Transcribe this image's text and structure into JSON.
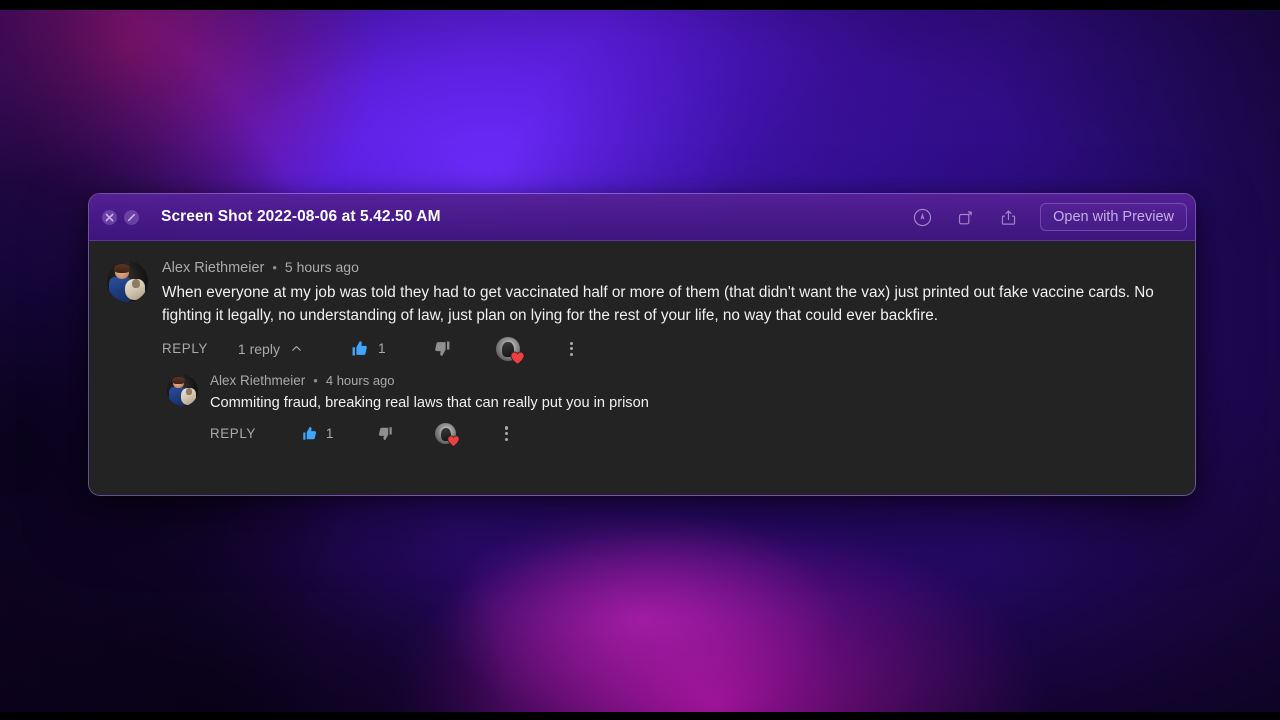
{
  "window": {
    "title": "Screen Shot 2022-08-06 at 5.42.50 AM",
    "close_label": "Close",
    "disabled_label": "Unavailable",
    "toolbar": {
      "markup_label": "Markup",
      "rotate_label": "Rotate Left",
      "share_label": "Share",
      "open_with_preview_label": "Open with Preview"
    }
  },
  "comments": [
    {
      "author": "Alex Riethmeier",
      "separator": "•",
      "time": "5 hours ago",
      "text": "When everyone at my job was told they had to get vaccinated half or more of them (that didn't want the vax) just printed out fake vaccine cards. No fighting it legally, no understanding of law, just plan on lying for the rest of your life, no way that could ever backfire.",
      "reply_label": "REPLY",
      "reply_count_label": "1 reply",
      "like_count": "1",
      "dislike_count": "",
      "hearted": true
    },
    {
      "author": "Alex Riethmeier",
      "separator": "•",
      "time": "4 hours ago",
      "text": "Commiting fraud, breaking real laws that can really put you in prison",
      "reply_label": "REPLY",
      "like_count": "1",
      "dislike_count": "",
      "hearted": true
    }
  ],
  "colors": {
    "like_blue": "#3ea6ff",
    "heart_red": "#ef3e3e",
    "panel_bg": "#232323",
    "title_text": "#ffffff",
    "meta_text": "#aaaaaa",
    "body_text": "#f1f1f1"
  }
}
